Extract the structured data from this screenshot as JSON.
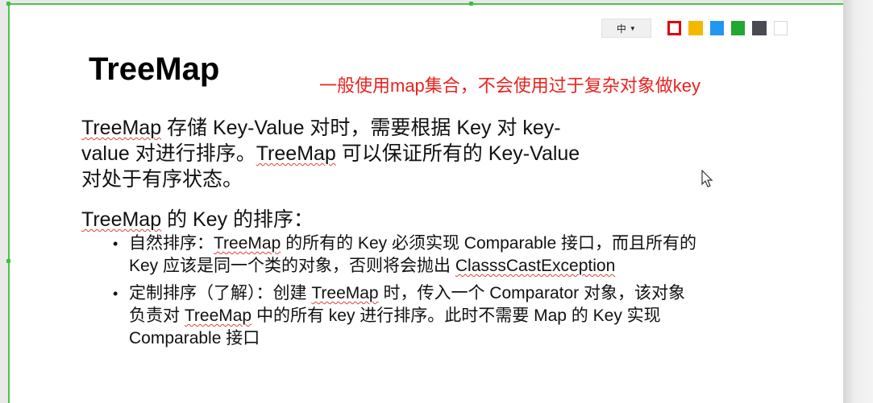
{
  "toolbar": {
    "lang_label": "中",
    "colors": [
      "#e00000",
      "#f5b800",
      "#2196f3",
      "#20a830",
      "#4a4a52",
      "#ffffff"
    ]
  },
  "slide": {
    "title": "TreeMap",
    "note": "一般使用map集合，不会使用过于复杂对象做key",
    "para": {
      "l1a": "TreeMap",
      "l1b": " 存储 Key-Value 对时，需要根据 Key 对 key-",
      "l2a": "value 对进行排序。",
      "l2b": "TreeMap",
      "l2c": " 可以保证所有的 Key-Value",
      "l3": "对处于有序状态。"
    },
    "subhead": {
      "a": "TreeMap",
      "b": " 的 Key 的排序："
    },
    "bullets": [
      {
        "a": "自然排序：",
        "b": "TreeMap",
        "c": " 的所有的 Key 必须实现 Comparable 接口，而且所有的 Key 应该是同一个类的对象，否则将会抛出 ",
        "d": "ClasssCastException"
      },
      {
        "a": "定制排序（了解）：创建 ",
        "b": "TreeMap",
        "c": " 时，传入一个 Comparator 对象，该对象负责对 ",
        "d": "TreeMap",
        "e": " 中的所有 key 进行排序。此时不需要 Map 的 Key 实现 Comparable 接口"
      }
    ]
  }
}
